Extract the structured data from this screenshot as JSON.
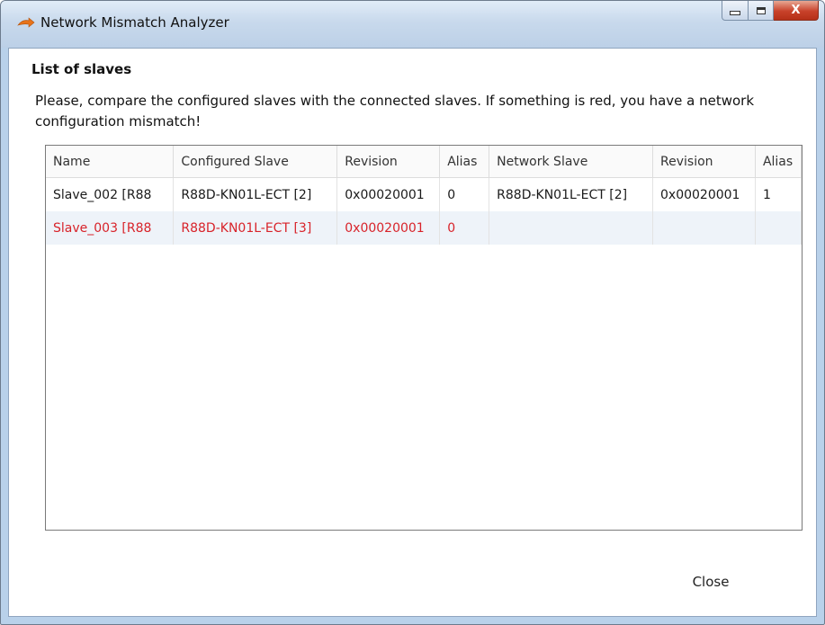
{
  "window": {
    "title": "Network Mismatch Analyzer",
    "icon": "orange-arrow-icon",
    "controls": {
      "minimize": "minimize-icon",
      "maximize": "maximize-icon",
      "close": "X"
    }
  },
  "heading": "List of slaves",
  "description": "Please, compare the configured slaves with the connected slaves. If something is red, you have a network configuration mismatch!",
  "table": {
    "columns": [
      "Name",
      "Configured Slave",
      "Revision",
      "Alias",
      "Network Slave",
      "Revision",
      "Alias"
    ],
    "rows": [
      {
        "cells": [
          "Slave_002 [R88",
          "R88D-KN01L-ECT [2]",
          "0x00020001",
          "0",
          "R88D-KN01L-ECT [2]",
          "0x00020001",
          "1"
        ],
        "mismatch": false
      },
      {
        "cells": [
          "Slave_003 [R88",
          "R88D-KN01L-ECT [3]",
          "0x00020001",
          "0",
          "",
          "",
          ""
        ],
        "mismatch": true
      }
    ]
  },
  "buttons": {
    "close": "Close"
  },
  "colors": {
    "mismatch": "#d8232a",
    "titlebar": "#c8d9ec",
    "row_alt": "#eef3f9"
  }
}
